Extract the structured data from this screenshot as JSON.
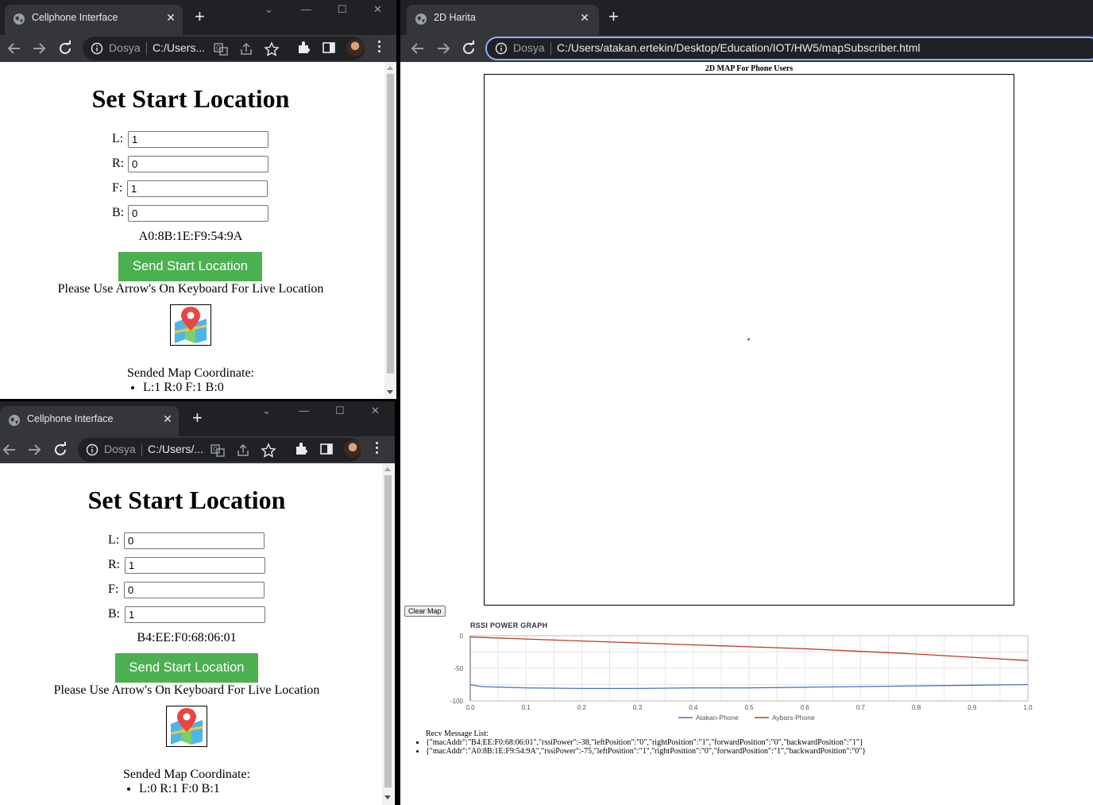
{
  "cellphone_top": {
    "tab_title": "Cellphone Interface",
    "scheme": "Dosya",
    "url": "C:/Users...",
    "heading": "Set Start Location",
    "fields": [
      {
        "label": "L:",
        "value": "1"
      },
      {
        "label": "R:",
        "value": "0"
      },
      {
        "label": "F:",
        "value": "1"
      },
      {
        "label": "B:",
        "value": "0"
      }
    ],
    "mac": "A0:8B:1E:F9:54:9A",
    "send_label": "Send Start Location",
    "hint": "Please Use Arrow's On Keyboard For Live Location",
    "coord_title": "Sended Map Coordinate:",
    "coord_items": [
      "L:1 R:0 F:1 B:0"
    ]
  },
  "cellphone_bottom": {
    "tab_title": "Cellphone Interface",
    "scheme": "Dosya",
    "url": "C:/Users/...",
    "heading": "Set Start Location",
    "fields": [
      {
        "label": "L:",
        "value": "0"
      },
      {
        "label": "R:",
        "value": "1"
      },
      {
        "label": "F:",
        "value": "0"
      },
      {
        "label": "B:",
        "value": "1"
      }
    ],
    "mac": "B4:EE:F0:68:06:01",
    "send_label": "Send Start Location",
    "hint": "Please Use Arrow's On Keyboard For Live Location",
    "coord_title": "Sended Map Coordinate:",
    "coord_items": [
      "L:0 R:1 F:0 B:1"
    ]
  },
  "map_window": {
    "tab_title": "2D Harita",
    "scheme": "Dosya",
    "url": "C:/Users/atakan.ertekin/Desktop/Education/IOT/HW5/mapSubscriber.html",
    "map_title": "2D MAP For Phone Users",
    "clear_label": "Clear Map",
    "graph_title": "RSSI POWER GRAPH",
    "recv_title": "Recv Message List:",
    "recv_items": [
      "{\"macAddr\":\"B4:EE:F0:68:06:01\",\"rssiPower\":-38,\"leftPosition\":\"0\",\"rightPosition\":\"1\",\"forwardPosition\":\"0\",\"backwardPosition\":\"1\"}",
      "{\"macAddr\":\"A0:8B:1E:F9:54:9A\",\"rssiPower\":-75,\"leftPosition\":\"1\",\"rightPosition\":\"0\",\"forwardPosition\":\"1\",\"backwardPosition\":\"0\"}"
    ]
  },
  "chart_data": {
    "type": "line",
    "title": "RSSI POWER GRAPH",
    "xlabel": "",
    "ylabel": "",
    "xlim": [
      0.0,
      1.0
    ],
    "ylim": [
      -100,
      0
    ],
    "x_ticks": [
      "0.0",
      "0.1",
      "0.2",
      "0.3",
      "0.4",
      "0.5",
      "0.6",
      "0.7",
      "0.8",
      "0.9",
      "1.0"
    ],
    "y_ticks": [
      "0",
      "-50",
      "-100"
    ],
    "grid": true,
    "legend_position": "bottom",
    "series": [
      {
        "name": "Atakan-Phone",
        "color": "#4472c4",
        "x": [
          0.0,
          0.02,
          0.1,
          0.2,
          0.3,
          0.4,
          0.5,
          0.6,
          0.7,
          0.8,
          0.9,
          1.0
        ],
        "y": [
          -75,
          -78,
          -80,
          -81,
          -81,
          -80,
          -80,
          -79,
          -78,
          -77,
          -76,
          -75
        ]
      },
      {
        "name": "Aybars-Phone",
        "color": "#c0391b",
        "x": [
          0.0,
          0.1,
          0.2,
          0.3,
          0.4,
          0.5,
          0.6,
          0.7,
          0.8,
          0.9,
          1.0
        ],
        "y": [
          -2,
          -5,
          -8,
          -11,
          -14,
          -17,
          -20,
          -24,
          -28,
          -33,
          -38
        ]
      }
    ]
  },
  "colors": {
    "tabstrip": "#202124",
    "toolbar": "#35363a",
    "send_button": "#4caf50",
    "map_dot": "#c0143c"
  }
}
